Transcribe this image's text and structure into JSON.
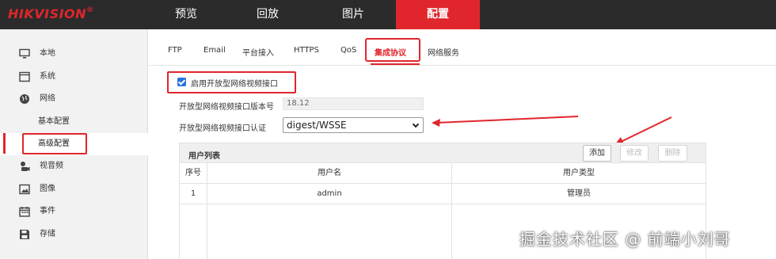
{
  "brand": {
    "logo_text": "HIKVISION",
    "logo_mark": "®",
    "accent_color": "#e0262c"
  },
  "topnav": [
    {
      "label": "预览"
    },
    {
      "label": "回放"
    },
    {
      "label": "图片"
    },
    {
      "label": "配置",
      "active": true
    }
  ],
  "sidebar": {
    "items": [
      {
        "label": "本地",
        "icon": "monitor-icon"
      },
      {
        "label": "系统",
        "icon": "window-icon"
      },
      {
        "label": "网络",
        "icon": "globe-icon"
      },
      {
        "label": "基本配置",
        "sub": true
      },
      {
        "label": "高级配置",
        "sub": true,
        "active": true
      },
      {
        "label": "视音频",
        "icon": "audio-video-icon"
      },
      {
        "label": "图像",
        "icon": "image-icon"
      },
      {
        "label": "事件",
        "icon": "calendar-icon"
      },
      {
        "label": "存储",
        "icon": "floppy-icon"
      }
    ]
  },
  "tabs": [
    {
      "label": "FTP"
    },
    {
      "label": "Email"
    },
    {
      "label": "平台接入"
    },
    {
      "label": "HTTPS"
    },
    {
      "label": "QoS"
    },
    {
      "label": "集成协议",
      "active": true
    },
    {
      "label": "网络服务"
    }
  ],
  "form": {
    "enable_label": "启用开放型网络视频接口",
    "enable_checked": true,
    "version_label": "开放型网络视频接口版本号",
    "version_value": "18.12",
    "auth_label": "开放型网络视频接口认证",
    "auth_value": "digest/WSSE"
  },
  "user_list": {
    "title": "用户列表",
    "buttons": {
      "add": "添加",
      "modify": "修改",
      "delete": "删除"
    },
    "columns": [
      "序号",
      "用户名",
      "用户类型"
    ],
    "rows": [
      {
        "index": "1",
        "username": "admin",
        "type": "管理员"
      }
    ]
  },
  "watermark": "掘金技术社区 @ 前端小刘哥"
}
